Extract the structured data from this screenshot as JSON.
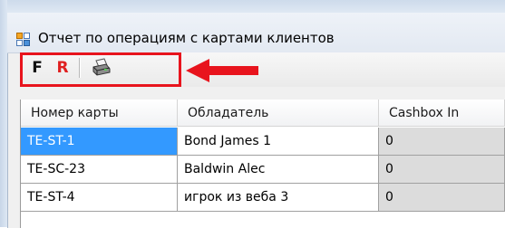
{
  "window": {
    "title": "Отчет по операциям с картами клиентов",
    "icon": "form-window-icon"
  },
  "toolbar": {
    "f_label": "F",
    "r_label": "R",
    "r_color": "#e02020",
    "print_icon": "printer-icon",
    "highlight_color": "#e8141d"
  },
  "grid": {
    "columns": [
      "Номер карты",
      "Обладатель",
      "Cashbox In"
    ],
    "rows": [
      [
        "TE-ST-1",
        "Bond James 1",
        "0"
      ],
      [
        "TE-SC-23",
        "Baldwin Alec",
        "0"
      ],
      [
        "TE-ST-4",
        "игрок из веба 3",
        "0"
      ]
    ],
    "selection_color": "#3399ff"
  }
}
